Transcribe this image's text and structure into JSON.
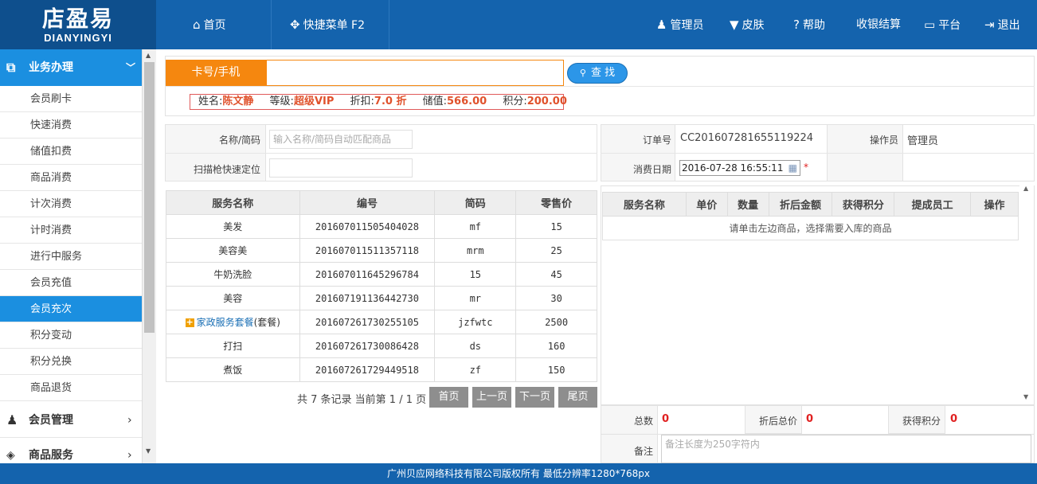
{
  "logo": {
    "line1": "店盈易",
    "line2": "DIANYINGYI"
  },
  "topnav": {
    "home": "首页",
    "quick_menu": "快捷菜单 F2",
    "admin": "管理员",
    "skin": "皮肤",
    "help": "帮助",
    "checkout": "收银结算",
    "platform": "平台",
    "logout": "退出"
  },
  "sidebar": {
    "header": "业务办理",
    "items": [
      "会员刷卡",
      "快速消费",
      "储值扣费",
      "商品消费",
      "计次消费",
      "计时消费",
      "进行中服务",
      "会员充值",
      "会员充次",
      "积分变动",
      "积分兑换",
      "商品退货"
    ],
    "active_index": 8,
    "groups": [
      "会员管理",
      "商品服务"
    ]
  },
  "card": {
    "label": "卡号/手机",
    "value": "",
    "search": "查 找"
  },
  "member": {
    "name_label": "姓名:",
    "name": "陈文静",
    "level_label": "等级:",
    "level": "超级VIP",
    "discount_label": "折扣:",
    "discount": "7.0 折",
    "balance_label": "储值:",
    "balance": "566.00",
    "points_label": "积分:",
    "points": "200.00"
  },
  "left_form": {
    "name_label": "名称/简码",
    "name_placeholder": "输入名称/简码自动匹配商品",
    "scan_label": "扫描枪快速定位",
    "scan_value": ""
  },
  "right_form": {
    "order_label": "订单号",
    "order_no": "CC201607281655119224",
    "operator_label": "操作员",
    "operator": "管理员",
    "date_label": "消费日期",
    "date": "2016-07-28 16:55:11",
    "required": "*"
  },
  "products": {
    "headers": [
      "服务名称",
      "编号",
      "简码",
      "零售价"
    ],
    "rows": [
      {
        "name": "美发",
        "code": "201607011505404028",
        "short": "mf",
        "price": "15"
      },
      {
        "name": "美容美",
        "code": "201607011511357118",
        "short": "mrm",
        "price": "25"
      },
      {
        "name": "牛奶洗脸",
        "code": "201607011645296784",
        "short": "15",
        "price": "45"
      },
      {
        "name": "美容",
        "code": "201607191136442730",
        "short": "mr",
        "price": "30"
      },
      {
        "name": "家政服务套餐",
        "suffix": "(套餐)",
        "code": "201607261730255105",
        "short": "jzfwtc",
        "price": "2500"
      },
      {
        "name": "打扫",
        "code": "201607261730086428",
        "short": "ds",
        "price": "160"
      },
      {
        "name": "煮饭",
        "code": "201607261729449518",
        "short": "zf",
        "price": "150"
      }
    ]
  },
  "pager": {
    "summary": "共 7 条记录 当前第 1 / 1 页",
    "first": "首页",
    "prev": "上一页",
    "next": "下一页",
    "last": "尾页"
  },
  "order_table": {
    "headers": [
      "服务名称",
      "单价",
      "数量",
      "折后金额",
      "获得积分",
      "提成员工",
      "操作"
    ],
    "empty": "请单击左边商品，选择需要入库的商品"
  },
  "totals": {
    "count_label": "总数",
    "count": "0",
    "total_label": "折后总价",
    "total": "0",
    "points_label": "获得积分",
    "points": "0",
    "remark_label": "备注",
    "remark_placeholder": "备注长度为250字符内"
  },
  "footer": "广州贝应网络科技有限公司版权所有 最低分辨率1280*768px",
  "colors": {
    "primary": "#1463ad",
    "accent": "#f5870f",
    "active": "#1b8fe0",
    "highlight": "#e0522c"
  }
}
